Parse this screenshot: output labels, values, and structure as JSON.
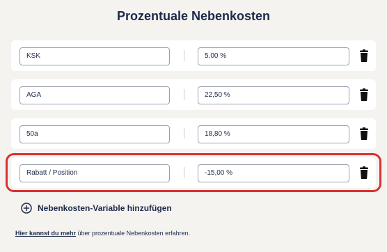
{
  "header": {
    "title": "Prozentuale Nebenkosten"
  },
  "cost_rows": [
    {
      "name": "KSK",
      "value": "5,00 %"
    },
    {
      "name": "AGA",
      "value": "22,50 %"
    },
    {
      "name": "50a",
      "value": "18,80 %"
    },
    {
      "name": "Rabatt / Position",
      "value": "-15,00 %"
    }
  ],
  "add_variable": {
    "label": "Nebenkosten-Variable hinzufügen",
    "icon": "plus-circle-icon"
  },
  "footer": {
    "link_text": "Hier kannst du mehr",
    "rest_text": " über prozentuale Nebenkosten erfahren."
  },
  "colors": {
    "text": "#1c2a4a",
    "highlight": "#d93030",
    "background": "#f5f3ef"
  }
}
